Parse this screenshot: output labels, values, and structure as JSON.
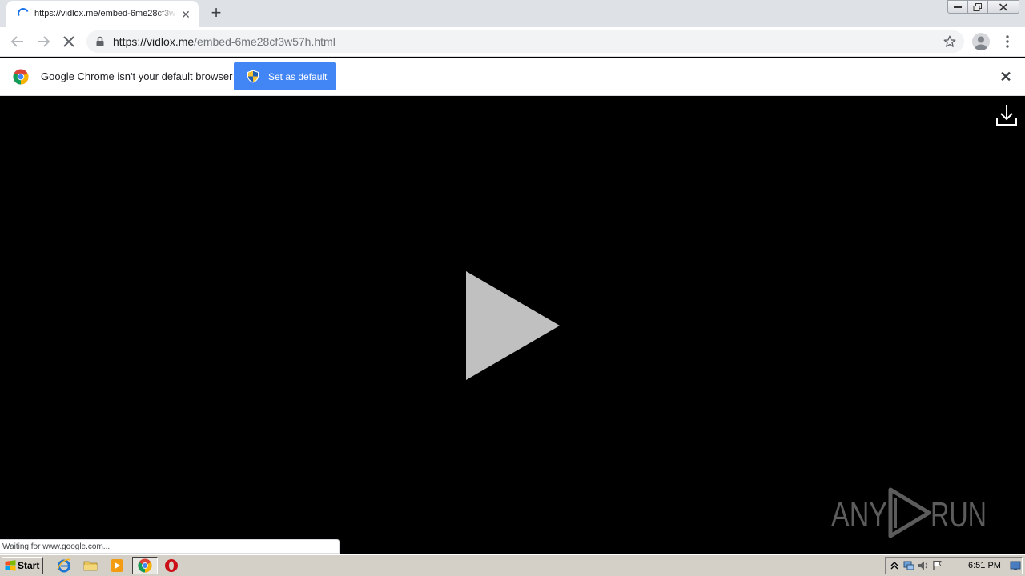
{
  "tab": {
    "title": "https://vidlox.me/embed-6me28cf3w57h.html",
    "close_glyph": "✕"
  },
  "new_tab_glyph": "+",
  "window_controls": [
    "minimize-icon",
    "restore-icon",
    "close-icon"
  ],
  "toolbar": {
    "back_icon": "back-arrow-icon",
    "forward_icon": "forward-arrow-icon",
    "stop_icon": "stop-icon",
    "url_host": "https://vidlox.me",
    "url_path": "/embed-6me28cf3w57h.html",
    "star_icon": "bookmark-star-icon",
    "profile_icon": "avatar-icon",
    "menu_icon": "kebab-menu-icon"
  },
  "infobar": {
    "message": "Google Chrome isn't your default browser",
    "button_label": "Set as default",
    "close_glyph": "✕"
  },
  "video": {
    "download_icon": "download-icon",
    "play_icon": "play-icon",
    "watermark": "ANY RUN"
  },
  "status_text": "Waiting for www.google.com...",
  "taskbar": {
    "start_label": "Start",
    "pinned": [
      "ie-icon",
      "explorer-icon",
      "media-player-icon",
      "chrome-icon",
      "opera-icon"
    ],
    "clock": "6:51 PM"
  },
  "colors": {
    "accent": "#4285f4",
    "tab_strip": "#dee1e6",
    "taskbar": "#d4d0c8",
    "video_bg": "#000000",
    "play_fill": "#c0c0c0"
  }
}
